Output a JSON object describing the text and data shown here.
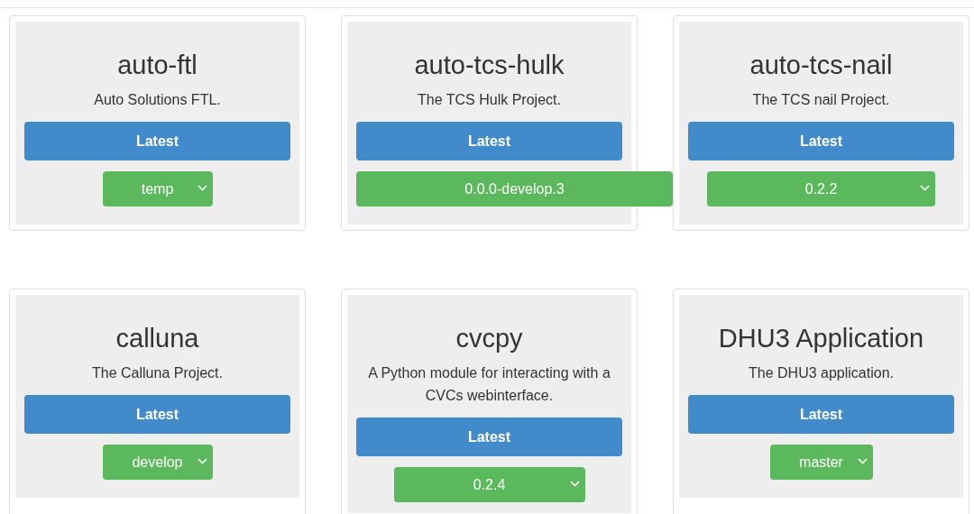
{
  "projects": [
    {
      "name": "auto-ftl",
      "description": "Auto Solutions FTL.",
      "button": "Latest",
      "version": "temp"
    },
    {
      "name": "auto-tcs-hulk",
      "description": "The TCS Hulk Project.",
      "button": "Latest",
      "version": "0.0.0-develop.3"
    },
    {
      "name": "auto-tcs-nail",
      "description": "The TCS nail Project.",
      "button": "Latest",
      "version": "0.2.2"
    },
    {
      "name": "calluna",
      "description": "The Calluna Project.",
      "button": "Latest",
      "version": "develop"
    },
    {
      "name": "cvcpy",
      "description": "A Python module for interacting with a CVCs webinterface.",
      "button": "Latest",
      "version": "0.2.4"
    },
    {
      "name": "DHU3 Application",
      "description": "The DHU3 application.",
      "button": "Latest",
      "version": "master"
    }
  ]
}
